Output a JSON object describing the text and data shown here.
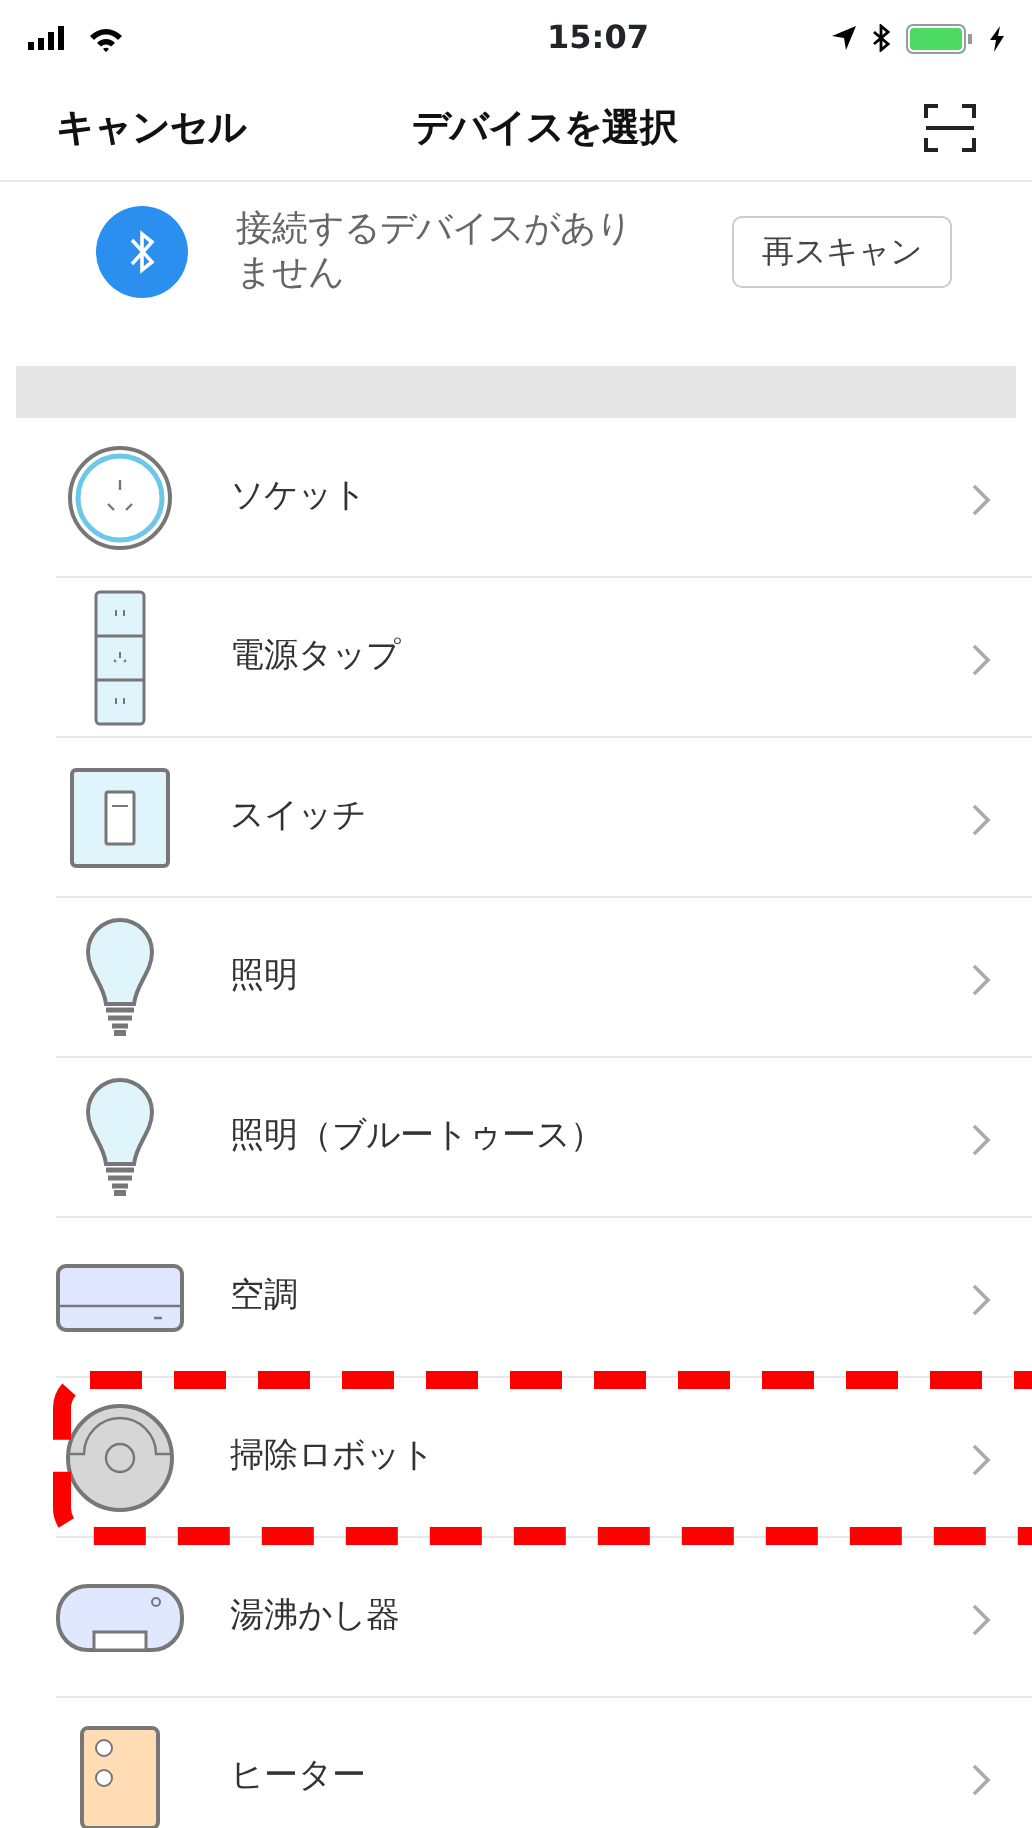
{
  "status_bar": {
    "time": "15:07"
  },
  "nav": {
    "cancel": "キャンセル",
    "title": "デバイスを選択"
  },
  "scan": {
    "message": "接続するデバイスがありません",
    "button": "再スキャン"
  },
  "devices": [
    {
      "kind": "socket",
      "label": "ソケット",
      "highlighted": false
    },
    {
      "kind": "strip",
      "label": "電源タップ",
      "highlighted": false
    },
    {
      "kind": "switch",
      "label": "スイッチ",
      "highlighted": false
    },
    {
      "kind": "bulb",
      "label": "照明",
      "highlighted": false
    },
    {
      "kind": "bulb",
      "label": "照明（ブルートゥース）",
      "highlighted": false
    },
    {
      "kind": "aircon",
      "label": "空調",
      "highlighted": false
    },
    {
      "kind": "robot",
      "label": "掃除ロボット",
      "highlighted": true
    },
    {
      "kind": "kettle",
      "label": "湯沸かし器",
      "highlighted": false
    },
    {
      "kind": "heater",
      "label": "ヒーター",
      "highlighted": false
    }
  ]
}
